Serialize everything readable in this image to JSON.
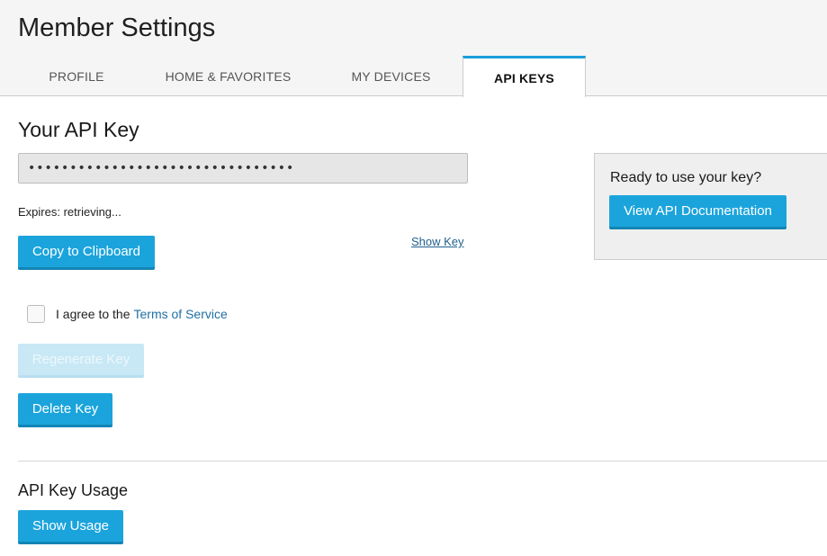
{
  "header": {
    "title": "Member Settings",
    "tabs": [
      {
        "label": "PROFILE"
      },
      {
        "label": "HOME & FAVORITES"
      },
      {
        "label": "MY DEVICES"
      },
      {
        "label": "API KEYS"
      }
    ],
    "active_tab": "API KEYS"
  },
  "api_key": {
    "section_title": "Your API Key",
    "masked_value": "••••••••••••••••••••••••••••••••",
    "expires_text": "Expires: retrieving...",
    "copy_label": "Copy to Clipboard",
    "show_key_label": "Show Key",
    "agree_text": "I agree to the",
    "terms_link": "Terms of Service",
    "agree_checked": false,
    "regenerate_label": "Regenerate Key",
    "delete_label": "Delete Key"
  },
  "usage": {
    "title": "API Key Usage",
    "show_usage_label": "Show Usage"
  },
  "side_panel": {
    "text": "Ready to use your key?",
    "button_label": "View API Documentation"
  },
  "colors": {
    "accent": "#1ba4dc",
    "accent_dark": "#1384b5",
    "disabled_button": "#c8e8f6",
    "link": "#1f6fa3"
  }
}
